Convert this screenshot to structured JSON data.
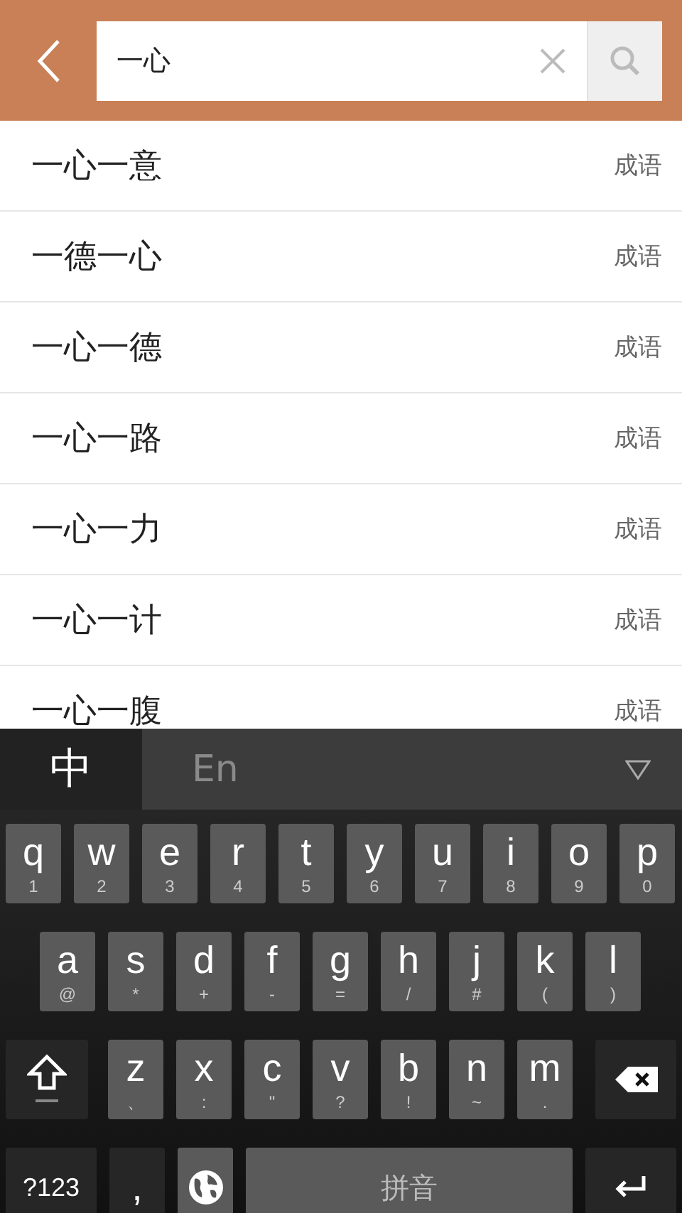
{
  "header": {
    "search": {
      "value": "一心"
    }
  },
  "results": [
    {
      "word": "一心一意",
      "tag": "成语"
    },
    {
      "word": "一德一心",
      "tag": "成语"
    },
    {
      "word": "一心一德",
      "tag": "成语"
    },
    {
      "word": "一心一路",
      "tag": "成语"
    },
    {
      "word": "一心一力",
      "tag": "成语"
    },
    {
      "word": "一心一计",
      "tag": "成语"
    },
    {
      "word": "一心一腹",
      "tag": "成语"
    }
  ],
  "keyboard": {
    "modes": [
      {
        "label": "中",
        "selected": true
      },
      {
        "label": "En",
        "selected": false
      }
    ],
    "rows": [
      [
        {
          "key": "q",
          "sub": "1"
        },
        {
          "key": "w",
          "sub": "2"
        },
        {
          "key": "e",
          "sub": "3"
        },
        {
          "key": "r",
          "sub": "4"
        },
        {
          "key": "t",
          "sub": "5"
        },
        {
          "key": "y",
          "sub": "6"
        },
        {
          "key": "u",
          "sub": "7"
        },
        {
          "key": "i",
          "sub": "8"
        },
        {
          "key": "o",
          "sub": "9"
        },
        {
          "key": "p",
          "sub": "0"
        }
      ],
      [
        {
          "key": "a",
          "sub": "@"
        },
        {
          "key": "s",
          "sub": "*"
        },
        {
          "key": "d",
          "sub": "+"
        },
        {
          "key": "f",
          "sub": "-"
        },
        {
          "key": "g",
          "sub": "="
        },
        {
          "key": "h",
          "sub": "/"
        },
        {
          "key": "j",
          "sub": "#"
        },
        {
          "key": "k",
          "sub": "("
        },
        {
          "key": "l",
          "sub": ")"
        }
      ],
      [
        {
          "key": "z",
          "sub": "、"
        },
        {
          "key": "x",
          "sub": ":"
        },
        {
          "key": "c",
          "sub": "\""
        },
        {
          "key": "v",
          "sub": "?"
        },
        {
          "key": "b",
          "sub": "!"
        },
        {
          "key": "n",
          "sub": "~"
        },
        {
          "key": "m",
          "sub": "."
        }
      ]
    ],
    "bottom": {
      "symbols": "?123",
      "comma": ",",
      "space": "拼音"
    }
  }
}
